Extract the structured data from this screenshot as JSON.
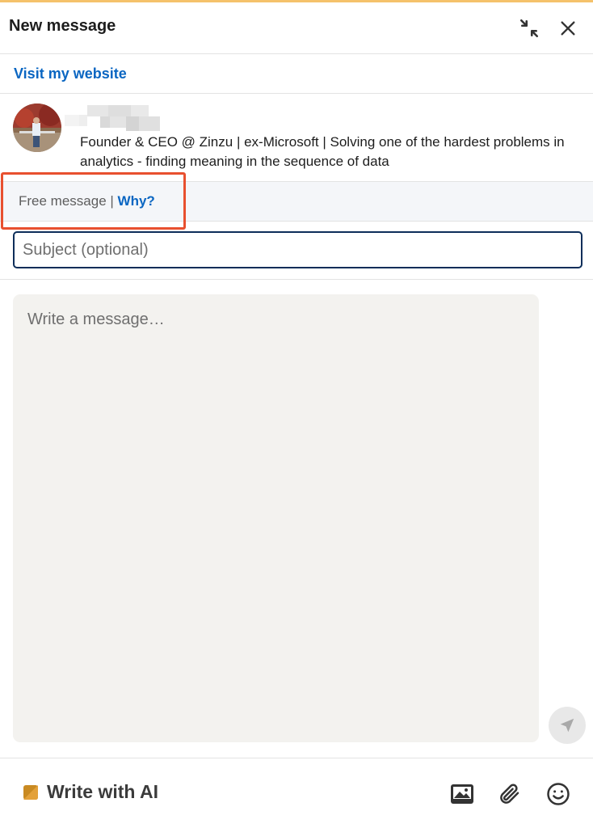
{
  "header": {
    "title": "New message",
    "minimize_icon": "minimize-icon",
    "close_icon": "close-icon"
  },
  "website": {
    "link_label": "Visit my website"
  },
  "recipient": {
    "headline": "Founder & CEO @ Zinzu | ex-Microsoft | Solving one of the hardest problems in analytics - finding meaning in the sequence of data"
  },
  "free_message": {
    "label": "Free message | ",
    "why_label": "Why?"
  },
  "form": {
    "subject_placeholder": "Subject (optional)",
    "subject_value": "",
    "message_placeholder": "Write a message…",
    "message_value": ""
  },
  "footer": {
    "ai_label": "Write with AI",
    "icons": [
      "image-icon",
      "paperclip-icon",
      "emoji-icon"
    ]
  },
  "colors": {
    "accent": "#0a66c2",
    "highlight": "#e8502f",
    "top_bar": "#f5c26b"
  }
}
